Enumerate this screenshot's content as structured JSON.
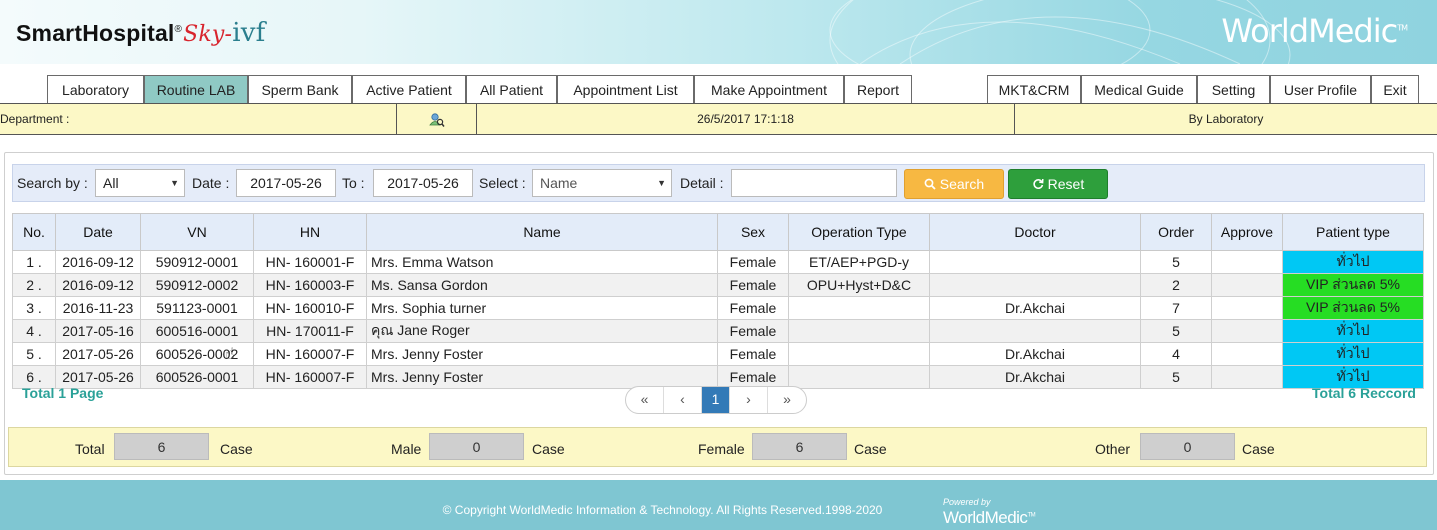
{
  "header": {
    "brand_main": "SmartHospital",
    "brand_reg": "®",
    "brand_sky": "Sky",
    "brand_dash": "-",
    "brand_ivf": "ivf",
    "logo_text": "WorldMedic",
    "logo_tm": "TM"
  },
  "tabs": {
    "left": [
      "Laboratory",
      "Routine LAB",
      "Sperm Bank",
      "Active Patient",
      "All Patient",
      "Appointment List",
      "Make Appointment",
      "Report"
    ],
    "right": [
      "MKT&CRM",
      "Medical Guide",
      "Setting",
      "User Profile",
      "Exit"
    ],
    "active": "Routine LAB"
  },
  "infobar": {
    "department_label": "Department :",
    "datetime": "26/5/2017 17:1:18",
    "mode": "By Laboratory",
    "icon": "user-search-icon"
  },
  "search": {
    "search_by_label": "Search by :",
    "search_by_value": "All",
    "date_label": "Date :",
    "date_from": "2017-05-26",
    "to_label": "To :",
    "date_to": "2017-05-26",
    "select_label": "Select :",
    "select_value": "Name",
    "detail_label": "Detail :",
    "detail_value": "",
    "search_button": "Search",
    "reset_button": "Reset"
  },
  "table": {
    "columns": [
      "No.",
      "Date",
      "VN",
      "HN",
      "Name",
      "Sex",
      "Operation Type",
      "Doctor",
      "Order",
      "Approve",
      "Patient type"
    ],
    "rows": [
      {
        "no": "1 .",
        "date": "2016-09-12",
        "vn": "590912-0001",
        "hn": "HN- 160001-F",
        "name": "Mrs. Emma Watson",
        "sex": "Female",
        "op": "ET/AEP+PGD-y",
        "doctor": "",
        "order": "5",
        "approve": "",
        "ptype": "ทั่วไป",
        "ptype_color": "#00c8f4"
      },
      {
        "no": "2 .",
        "date": "2016-09-12",
        "vn": "590912-0002",
        "hn": "HN- 160003-F",
        "name": "Ms. Sansa Gordon",
        "sex": "Female",
        "op": "OPU+Hyst+D&C",
        "doctor": "",
        "order": "2",
        "approve": "",
        "ptype": "VIP ส่วนลด 5%",
        "ptype_color": "#26dd23"
      },
      {
        "no": "3 .",
        "date": "2016-11-23",
        "vn": "591123-0001",
        "hn": "HN- 160010-F",
        "name": "Mrs. Sophia turner",
        "sex": "Female",
        "op": "",
        "doctor": "Dr.Akchai",
        "order": "7",
        "approve": "",
        "ptype": "VIP ส่วนลด 5%",
        "ptype_color": "#26dd23"
      },
      {
        "no": "4 .",
        "date": "2017-05-16",
        "vn": "600516-0001",
        "hn": "HN- 170011-F",
        "name": "คุณ Jane Roger",
        "sex": "Female",
        "op": "",
        "doctor": "",
        "order": "5",
        "approve": "",
        "ptype": "ทั่วไป",
        "ptype_color": "#00c8f4"
      },
      {
        "no": "5 .",
        "date": "2017-05-26",
        "vn": "600526-0002",
        "hn": "HN- 160007-F",
        "name": "Mrs. Jenny Foster",
        "sex": "Female",
        "op": "",
        "doctor": "Dr.Akchai",
        "order": "4",
        "approve": "",
        "ptype": "ทั่วไป",
        "ptype_color": "#00c8f4"
      },
      {
        "no": "6 .",
        "date": "2017-05-26",
        "vn": "600526-0001",
        "hn": "HN- 160007-F",
        "name": "Mrs. Jenny Foster",
        "sex": "Female",
        "op": "",
        "doctor": "Dr.Akchai",
        "order": "5",
        "approve": "",
        "ptype": "ทั่วไป",
        "ptype_color": "#00c8f4"
      }
    ]
  },
  "pagination": {
    "total_page": "Total 1 Page",
    "total_record": "Total 6 Reccord",
    "first": "«",
    "prev": "‹",
    "current": "1",
    "next": "›",
    "last": "»"
  },
  "summary": {
    "total_label": "Total",
    "total_value": "6",
    "male_label": "Male",
    "male_value": "0",
    "female_label": "Female",
    "female_value": "6",
    "other_label": "Other",
    "other_value": "0",
    "case_label": "Case"
  },
  "footer": {
    "copyright": "© Copyright WorldMedic Information & Technology. All Rights Reserved.1998-2020",
    "powered_by": "Powered by",
    "powered_logo": "WorldMedic",
    "powered_tm": "TM"
  }
}
